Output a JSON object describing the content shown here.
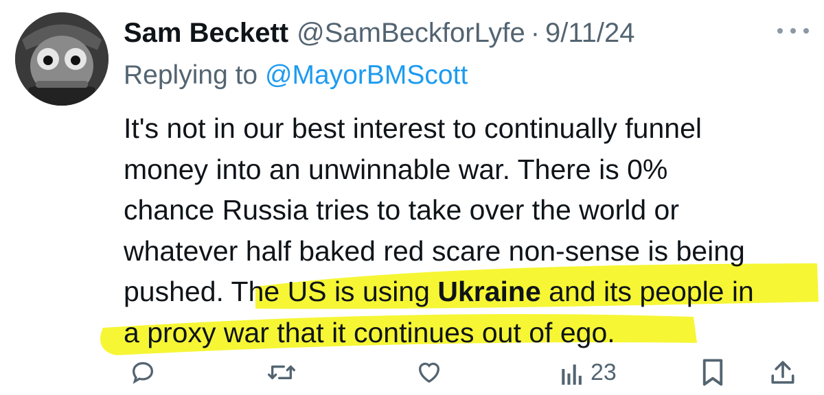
{
  "tweet": {
    "display_name": "Sam Beckett",
    "handle": "@SamBeckforLyfe",
    "separator": "·",
    "date": "9/11/24",
    "replying_prefix": "Replying to",
    "replying_to": "@MayorBMScott",
    "body": {
      "line1": "It's not in our best interest to continually funnel",
      "line2": "money into an unwinnable war. There is 0%",
      "line3": "chance Russia tries to take over the world or",
      "line4": "whatever half baked red scare non-sense is being",
      "line5_plain": "pushed. T",
      "line5_hl_a": "he US is using ",
      "line5_bold": "Ukraine",
      "line5_hl_b": " and its people in",
      "line6": "a proxy war that it continues out of ego."
    },
    "views_count": "23"
  },
  "colors": {
    "highlight": "#f5f51f",
    "muted": "#536471",
    "link": "#1d9bf0",
    "text": "#0f1419"
  },
  "icons": [
    "reply-icon",
    "retweet-icon",
    "like-icon",
    "views-icon",
    "bookmark-icon",
    "share-icon",
    "more-icon"
  ]
}
